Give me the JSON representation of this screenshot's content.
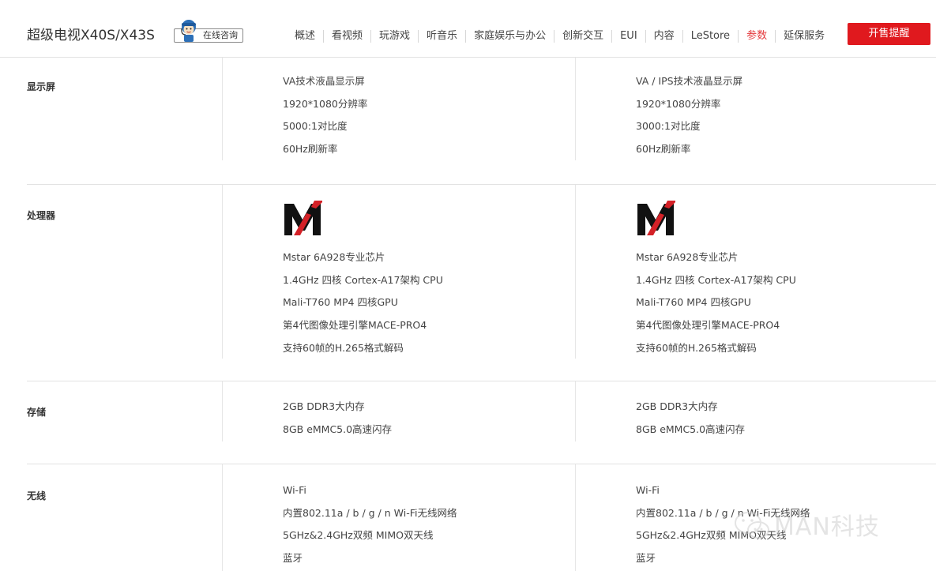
{
  "header": {
    "product_title": "超级电视X40S/X43S",
    "consult_label": "在线咨询",
    "nav": [
      {
        "label": "概述",
        "active": false
      },
      {
        "label": "看视频",
        "active": false
      },
      {
        "label": "玩游戏",
        "active": false
      },
      {
        "label": "听音乐",
        "active": false
      },
      {
        "label": "家庭娱乐与办公",
        "active": false
      },
      {
        "label": "创新交互",
        "active": false
      },
      {
        "label": "EUI",
        "active": false
      },
      {
        "label": "内容",
        "active": false
      },
      {
        "label": "LeStore",
        "active": false
      },
      {
        "label": "参数",
        "active": true
      },
      {
        "label": "延保服务",
        "active": false
      }
    ],
    "notify_button": "开售提醒"
  },
  "colors": {
    "accent_red": "#e0191e",
    "active_nav": "#e4393c",
    "text": "#444444",
    "divider": "#e2e2e2"
  },
  "specs": {
    "display": {
      "label": "显示屏",
      "col1": [
        "VA技术液晶显示屏",
        "1920*1080分辨率",
        "5000:1对比度",
        "60Hz刷新率"
      ],
      "col2": [
        "VA / IPS技术液晶显示屏",
        "1920*1080分辨率",
        "3000:1对比度",
        "60Hz刷新率"
      ]
    },
    "processor": {
      "label": "处理器",
      "logo_icon": "mstar-logo-icon",
      "col1": [
        "Mstar 6A928专业芯片",
        "1.4GHz 四核 Cortex-A17架构 CPU",
        "Mali-T760 MP4 四核GPU",
        "第4代图像处理引擎MACE-PRO4",
        "支持60帧的H.265格式解码"
      ],
      "col2": [
        "Mstar 6A928专业芯片",
        "1.4GHz 四核 Cortex-A17架构 CPU",
        "Mali-T760 MP4 四核GPU",
        "第4代图像处理引擎MACE-PRO4",
        "支持60帧的H.265格式解码"
      ]
    },
    "storage": {
      "label": "存储",
      "col1": [
        "2GB DDR3大内存",
        "8GB eMMC5.0高速闪存"
      ],
      "col2": [
        "2GB DDR3大内存",
        "8GB eMMC5.0高速闪存"
      ]
    },
    "wireless": {
      "label": "无线",
      "col1": [
        "Wi-Fi",
        "内置802.11a / b / g / n Wi-Fi无线网络",
        "5GHz&2.4GHz双频 MIMO双天线",
        "蓝牙"
      ],
      "col2": [
        "Wi-Fi",
        "内置802.11a / b / g / n Wi-Fi无线网络",
        "5GHz&2.4GHz双频 MIMO双天线",
        "蓝牙"
      ]
    }
  },
  "watermark": {
    "text": "MAN科技"
  }
}
